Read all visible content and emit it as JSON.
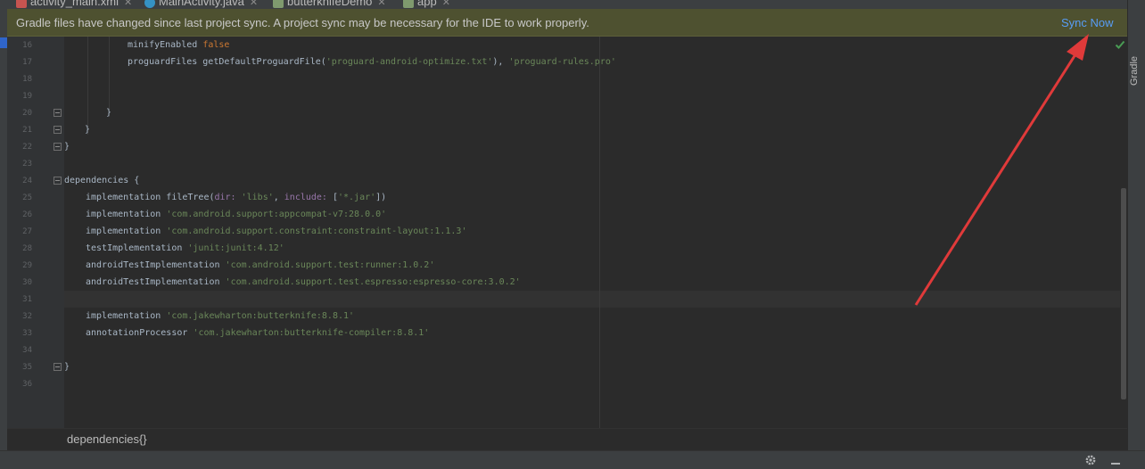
{
  "tabs": [
    {
      "label": "activity_main.xml",
      "icon": "xml-file-icon"
    },
    {
      "label": "MainActivity.java",
      "icon": "java-class-icon"
    },
    {
      "label": "butterknifeDemo",
      "icon": "gradle-icon"
    },
    {
      "label": "app",
      "icon": "gradle-icon"
    }
  ],
  "notification": {
    "message": "Gradle files have changed since last project sync. A project sync may be necessary for the IDE to work properly.",
    "action": "Sync Now"
  },
  "right_panel": {
    "label": "Gradle"
  },
  "line_numbers": [
    "16",
    "17",
    "18",
    "19",
    "20",
    "21",
    "22",
    "23",
    "24",
    "25",
    "26",
    "27",
    "28",
    "29",
    "30",
    "31",
    "32",
    "33",
    "34",
    "35",
    "36"
  ],
  "code": {
    "l16": {
      "text": "minifyEnabled",
      "value": "false"
    },
    "l17": {
      "text": "proguardFiles getDefaultProguardFile(",
      "arg1": "'proguard-android-optimize.txt'",
      "sep": "), ",
      "arg2": "'proguard-rules.pro'"
    },
    "l20": "}",
    "l21": "}",
    "l22": "}",
    "l24": "dependencies {",
    "l25": {
      "prefix": "implementation fileTree(",
      "p1": "dir: ",
      "s1": "'libs'",
      "c": ", ",
      "p2": "include: ",
      "b1": "[",
      "s2": "'*.jar'",
      "end": "])"
    },
    "l26": {
      "prefix": "implementation ",
      "str": "'com.android.support:appcompat-v7:28.0.0'"
    },
    "l27": {
      "prefix": "implementation ",
      "str": "'com.android.support.constraint:constraint-layout:1.1.3'"
    },
    "l28": {
      "prefix": "testImplementation ",
      "str": "'junit:junit:4.12'"
    },
    "l29": {
      "prefix": "androidTestImplementation ",
      "str": "'com.android.support.test:runner:1.0.2'"
    },
    "l30": {
      "prefix": "androidTestImplementation ",
      "str": "'com.android.support.test.espresso:espresso-core:3.0.2'"
    },
    "l32": {
      "prefix": "implementation ",
      "str": "'com.jakewharton:butterknife:8.8.1'"
    },
    "l33": {
      "prefix": "annotationProcessor ",
      "str": "'com.jakewharton:butterknife-compiler:8.8.1'"
    },
    "l35": "}"
  },
  "breadcrumb": "dependencies{}",
  "colors": {
    "keyword": "#cc7832",
    "string": "#6a8759",
    "param": "#9876aa",
    "link": "#589df6",
    "annotation_arrow": "#e03a3a"
  },
  "status_icons": [
    "gear-icon",
    "minimize-icon"
  ]
}
